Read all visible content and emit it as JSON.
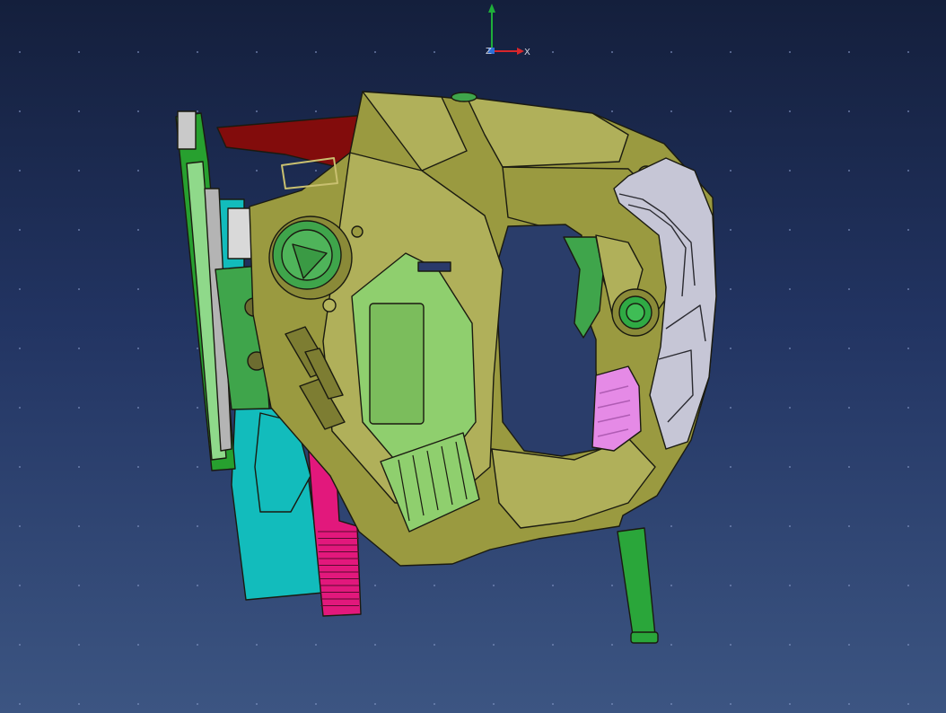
{
  "viewport": {
    "background_top": "#141f3c",
    "background_bottom": "#3c5582"
  },
  "compass": {
    "x_label": "X",
    "z_label": "Z",
    "x_color": "#d8262b",
    "y_color": "#1fae3a",
    "z_color": "#2f6fd6"
  },
  "model": {
    "body_color": "#9a9a40",
    "body_light": "#b0b05a",
    "panel_green": "#8fcf6e",
    "knob_green": "#3fa54b",
    "blade_green": "#27a02f",
    "cyan_part": "#12bcbc",
    "magenta_part": "#e2187c",
    "pink_button": "#e58ae6",
    "silver_part": "#c6c6d6",
    "red_part": "#820c0c",
    "cable_green": "#2aa63a"
  }
}
